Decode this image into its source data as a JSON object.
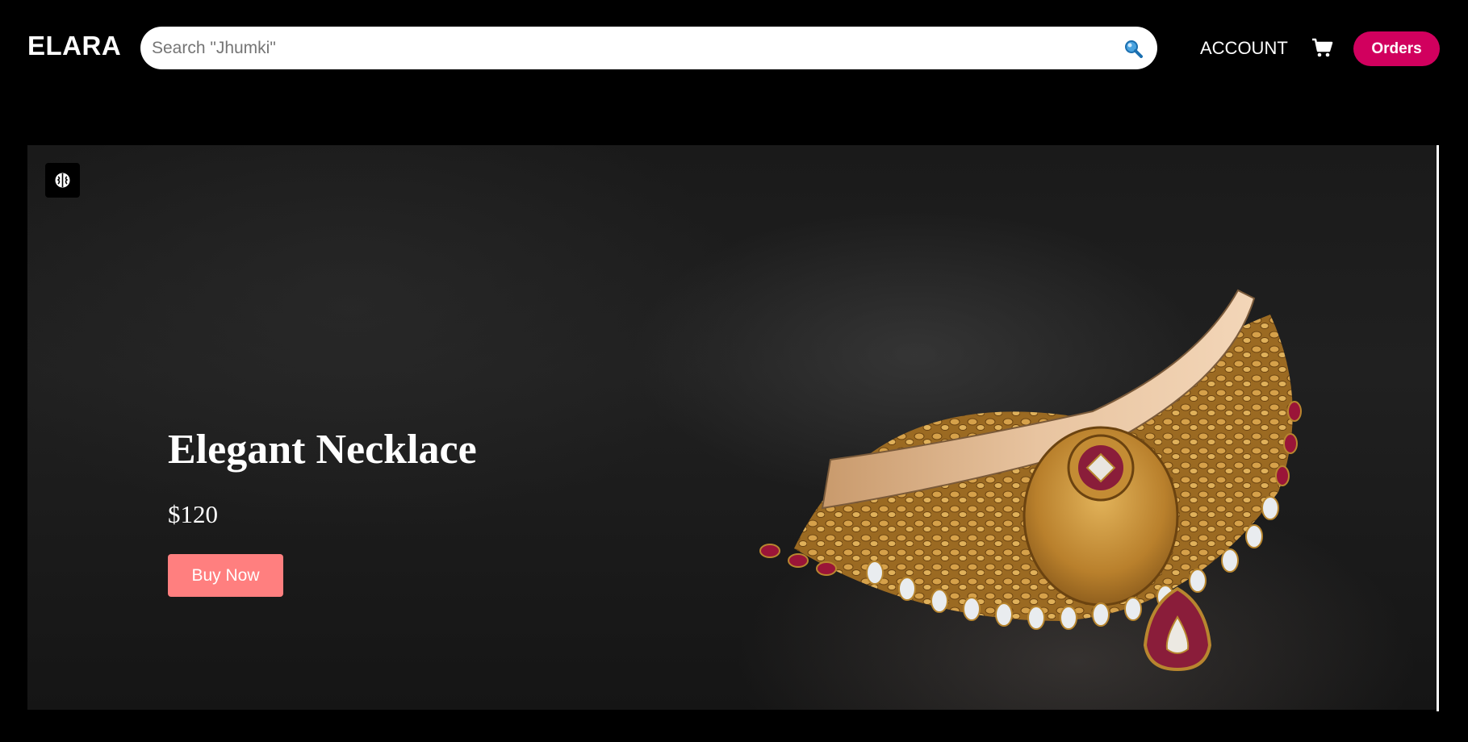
{
  "header": {
    "logo": "ELARA",
    "search": {
      "placeholder": "Search \"Jhumki\"",
      "value": "",
      "icon": "search-icon"
    },
    "account_label": "ACCOUNT",
    "cart_icon": "cart-icon",
    "orders_label": "Orders",
    "orders_color": "#d1005e"
  },
  "hero": {
    "badge_icon": "brain-icon",
    "title": "Elegant Necklace",
    "price": "$120",
    "buy_label": "Buy Now",
    "buy_color": "#ff7f7f",
    "image": "gold-necklace-image"
  }
}
